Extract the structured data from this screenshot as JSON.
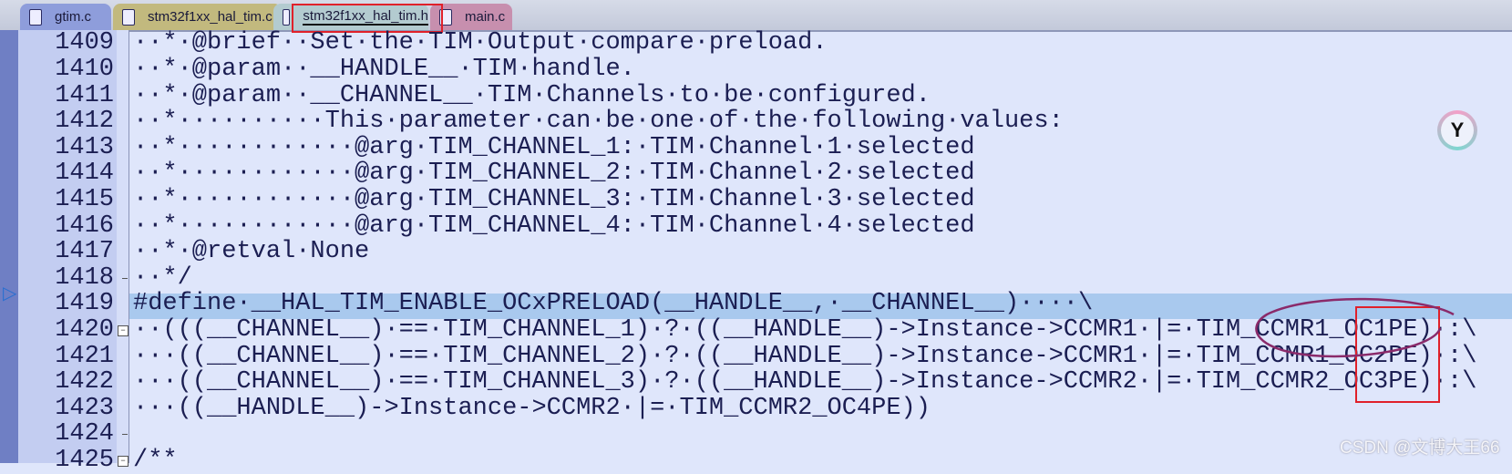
{
  "tabs": [
    {
      "label": "gtim.c",
      "color": "#8e9ddb",
      "active": false
    },
    {
      "label": "stm32f1xx_hal_tim.c",
      "color": "#c2b97e",
      "active": false
    },
    {
      "label": "stm32f1xx_hal_tim.h",
      "color": "#b3cbd0",
      "active": true
    },
    {
      "label": "main.c",
      "color": "#c78fae",
      "active": false
    }
  ],
  "editor": {
    "current_line": "1419",
    "lines": [
      {
        "num": "1409",
        "text": "··*·@brief··Set·the·TIM·Output·compare·preload."
      },
      {
        "num": "1410",
        "text": "··*·@param··__HANDLE__·TIM·handle."
      },
      {
        "num": "1411",
        "text": "··*·@param··__CHANNEL__·TIM·Channels·to·be·configured."
      },
      {
        "num": "1412",
        "text": "··*··········This·parameter·can·be·one·of·the·following·values:"
      },
      {
        "num": "1413",
        "text": "··*············@arg·TIM_CHANNEL_1:·TIM·Channel·1·selected"
      },
      {
        "num": "1414",
        "text": "··*············@arg·TIM_CHANNEL_2:·TIM·Channel·2·selected"
      },
      {
        "num": "1415",
        "text": "··*············@arg·TIM_CHANNEL_3:·TIM·Channel·3·selected"
      },
      {
        "num": "1416",
        "text": "··*············@arg·TIM_CHANNEL_4:·TIM·Channel·4·selected"
      },
      {
        "num": "1417",
        "text": "··*·@retval·None"
      },
      {
        "num": "1418",
        "text": "··*/"
      },
      {
        "num": "1419",
        "text": "#define·__HAL_TIM_ENABLE_OCxPRELOAD(__HANDLE__,·__CHANNEL__)····\\"
      },
      {
        "num": "1420",
        "text": "··(((__CHANNEL__)·==·TIM_CHANNEL_1)·?·((__HANDLE__)->Instance->CCMR1·|=·TIM_CCMR1_OC1PE)·:\\"
      },
      {
        "num": "1421",
        "text": "···((__CHANNEL__)·==·TIM_CHANNEL_2)·?·((__HANDLE__)->Instance->CCMR1·|=·TIM_CCMR1_OC2PE)·:\\"
      },
      {
        "num": "1422",
        "text": "···((__CHANNEL__)·==·TIM_CHANNEL_3)·?·((__HANDLE__)->Instance->CCMR2·|=·TIM_CCMR2_OC3PE)·:\\"
      },
      {
        "num": "1423",
        "text": "···((__HANDLE__)->Instance->CCMR2·|=·TIM_CCMR2_OC4PE))"
      },
      {
        "num": "1424",
        "text": ""
      },
      {
        "num": "1425",
        "text": "/**"
      }
    ]
  },
  "annotation_colors": {
    "box": "#e0202a",
    "circle": "#8a2a6a"
  },
  "watermark": "CSDN @文博大王66",
  "icons": {
    "ai_assistant": "y-logo-icon",
    "current_line_marker": "triangle-right-icon"
  }
}
